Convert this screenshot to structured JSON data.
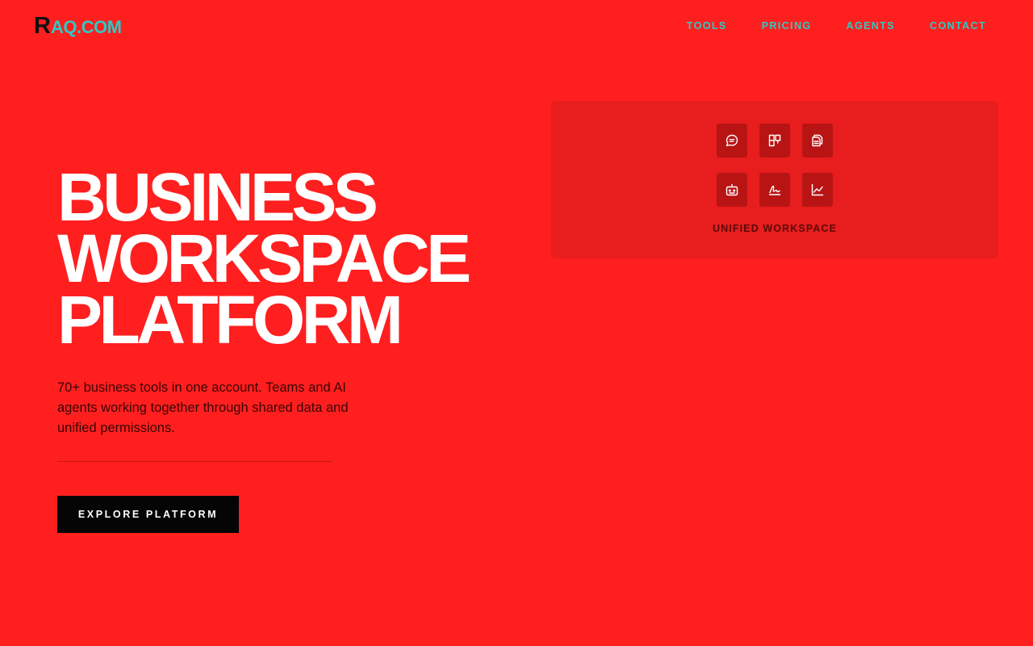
{
  "header": {
    "logo_mark": "R",
    "logo_text": "AQ.COM",
    "nav": [
      {
        "label": "TOOLS"
      },
      {
        "label": "PRICING"
      },
      {
        "label": "AGENTS"
      },
      {
        "label": "CONTACT"
      }
    ]
  },
  "hero": {
    "title_lines": [
      "BUSINESS",
      "WORKSPACE",
      "PLATFORM"
    ],
    "description": "70+ business tools in one account. Teams and AI agents working together through shared data and unified permissions.",
    "cta_label": "EXPLORE PLATFORM"
  },
  "workspace_card": {
    "label": "UNIFIED WORKSPACE",
    "icons": [
      "chat-icon",
      "kanban-icon",
      "documents-icon",
      "robot-icon",
      "signature-icon",
      "chart-icon"
    ]
  },
  "colors": {
    "background": "#ff1f1f",
    "accent": "#2ec9c4",
    "card": "#e81d1d",
    "tile": "#b81414",
    "cta": "#050505"
  }
}
